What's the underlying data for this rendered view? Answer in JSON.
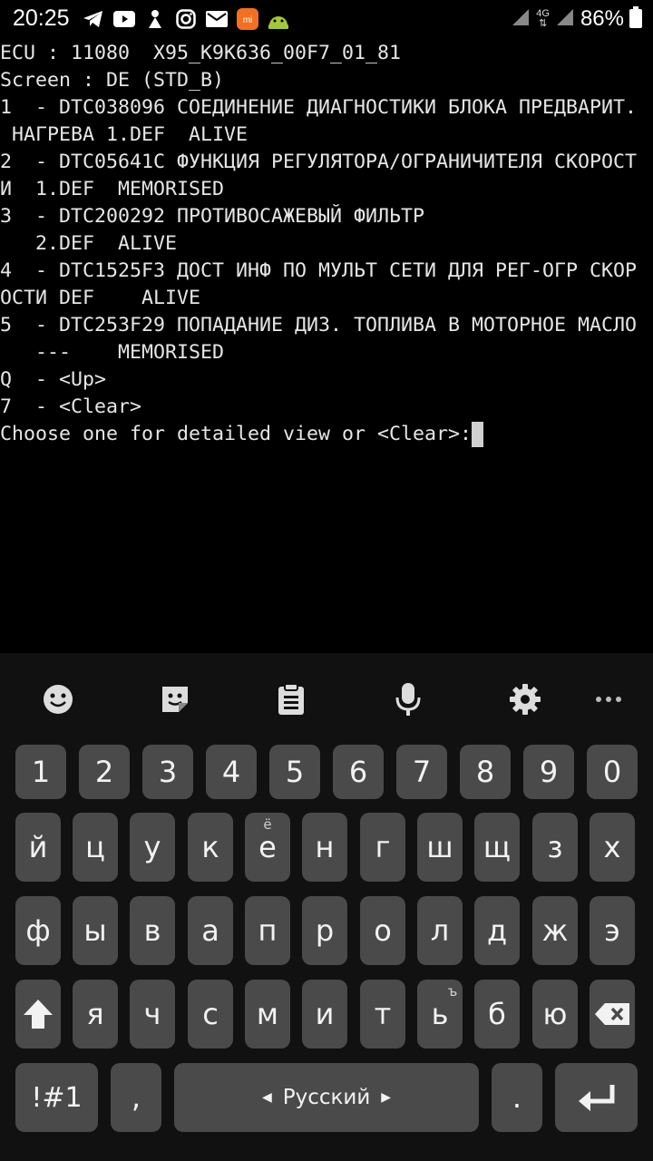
{
  "status_bar": {
    "time": "20:25",
    "left_icons": [
      "telegram-icon",
      "youtube-icon",
      "notification-icon",
      "instagram-icon",
      "mail-icon",
      "mi-icon",
      "android-icon"
    ],
    "network_label": "4G",
    "battery_percent": "86%"
  },
  "terminal": {
    "lines": [
      "ECU : 11080  X95_K9K636_00F7_01_81",
      "Screen : DE (STD_B)",
      "1  - DTC038096 СОЕДИНЕНИЕ ДИАГНОСТИКИ БЛОКА ПРЕДВАРИТ.",
      " НАГРЕВА 1.DEF  ALIVE",
      "2  - DTC05641C ФУНКЦИЯ РЕГУЛЯТОРА/ОГРАНИЧИТЕЛЯ СКОРОСТ",
      "И  1.DEF  MEMORISED",
      "3  - DTC200292 ПРОТИВОСАЖЕВЫЙ ФИЛЬТР",
      "   2.DEF  ALIVE",
      "4  - DTC1525F3 ДОСТ ИНФ ПО МУЛЬТ СЕТИ ДЛЯ РЕГ-ОГР СКОР",
      "ОСТИ DEF    ALIVE",
      "5  - DTC253F29 ПОПАДАНИЕ ДИЗ. ТОПЛИВА В МОТОРНОЕ МАСЛО",
      "   ---    MEMORISED",
      "Q  - <Up>",
      "7  - <Clear>"
    ],
    "prompt": "Choose one for detailed view or <Clear>:"
  },
  "keyboard": {
    "toolbar": [
      "emoji-icon",
      "sticker-icon",
      "clipboard-icon",
      "microphone-icon",
      "settings-icon",
      "more-icon"
    ],
    "number_row": [
      "1",
      "2",
      "3",
      "4",
      "5",
      "6",
      "7",
      "8",
      "9",
      "0"
    ],
    "row1": [
      "й",
      "ц",
      "у",
      "к",
      "е",
      "н",
      "г",
      "ш",
      "щ",
      "з",
      "х"
    ],
    "row1_hint_e": "ё",
    "row2": [
      "ф",
      "ы",
      "в",
      "а",
      "п",
      "р",
      "о",
      "л",
      "д",
      "ж",
      "э"
    ],
    "row3": [
      "я",
      "ч",
      "с",
      "м",
      "и",
      "т",
      "ь",
      "б",
      "ю"
    ],
    "row3_hint_soft": "ъ",
    "symbols_label": "!#1",
    "comma_label": ",",
    "space_label": "Русский",
    "period_label": "."
  }
}
